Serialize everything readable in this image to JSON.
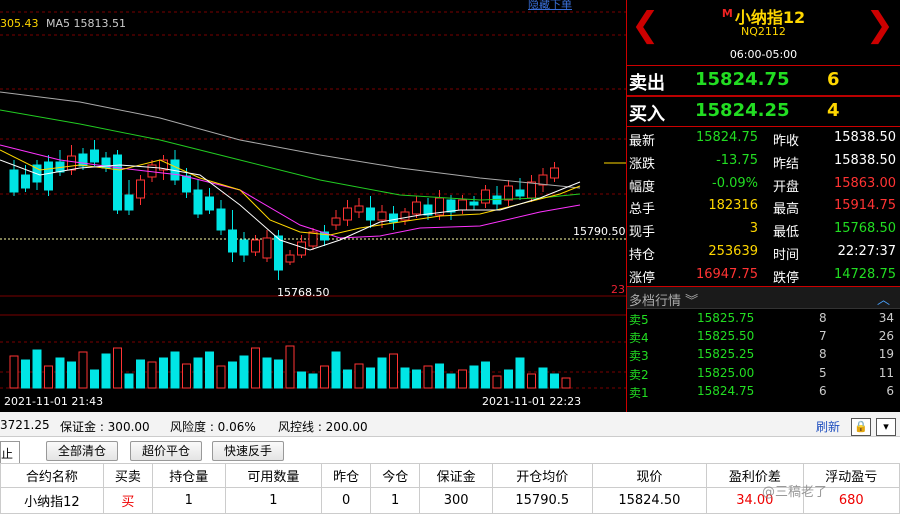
{
  "chart": {
    "ma_legend_value": "305.43",
    "ma_legend_ma5": "MA5  15813.51",
    "hide_order": "隐藏下单",
    "price_line_label": "15790.50",
    "low_label": "15768.50",
    "side_number": "23",
    "time_left": "2021-11-01 21:43",
    "time_right": "2021-11-01 22:23",
    "colors": {
      "up": "#ff3333",
      "down": "#00e5e5",
      "ma1": "#ffffff",
      "ma2": "#ffd700",
      "ma3": "#ff33ff",
      "ma4": "#22cc22",
      "ma5": "#aaaaaa"
    }
  },
  "panel": {
    "prev_icon": "chevron-left",
    "next_icon": "chevron-right",
    "badge": "M",
    "title": "小纳指12",
    "code": "NQ2112",
    "hours": "06:00-05:00",
    "sell": {
      "label": "卖出",
      "price": "15824.75",
      "vol": "6"
    },
    "buy": {
      "label": "买入",
      "price": "15824.25",
      "vol": "4"
    },
    "quote_rows": [
      {
        "k1": "最新",
        "v1": "15824.75",
        "c1": "g",
        "k2": "昨收",
        "v2": "15838.50",
        "c2": "w"
      },
      {
        "k1": "涨跌",
        "v1": "-13.75",
        "c1": "g",
        "k2": "昨结",
        "v2": "15838.50",
        "c2": "w"
      },
      {
        "k1": "幅度",
        "v1": "-0.09%",
        "c1": "g",
        "k2": "开盘",
        "v2": "15863.00",
        "c2": "r"
      },
      {
        "k1": "总手",
        "v1": "182316",
        "c1": "y",
        "k2": "最高",
        "v2": "15914.75",
        "c2": "r"
      },
      {
        "k1": "现手",
        "v1": "3",
        "c1": "y",
        "k2": "最低",
        "v2": "15768.50",
        "c2": "g"
      },
      {
        "k1": "持仓",
        "v1": "253639",
        "c1": "y",
        "k2": "时间",
        "v2": "22:27:37",
        "c2": "w"
      },
      {
        "k1": "涨停",
        "v1": "16947.75",
        "c1": "r",
        "k2": "跌停",
        "v2": "14728.75",
        "c2": "g"
      }
    ],
    "depth_title": "多档行情",
    "depth": [
      {
        "l": "卖5",
        "p": "15825.75",
        "v": "8",
        "t": "34"
      },
      {
        "l": "卖4",
        "p": "15825.50",
        "v": "7",
        "t": "26"
      },
      {
        "l": "卖3",
        "p": "15825.25",
        "v": "8",
        "t": "19"
      },
      {
        "l": "卖2",
        "p": "15825.00",
        "v": "5",
        "t": "11"
      },
      {
        "l": "卖1",
        "p": "15824.75",
        "v": "6",
        "t": "6"
      }
    ]
  },
  "account": {
    "balance_partial": "3721.25",
    "margin": "保证金 : 300.00",
    "risk": "风险度 : 0.06%",
    "risk_line": "风控线 : 200.00",
    "refresh": "刷新"
  },
  "buttons": {
    "tab": "止盈",
    "close_all": "全部清仓",
    "super_close": "超价平仓",
    "quick_reverse": "快速反手"
  },
  "table": {
    "headers": [
      "合约名称",
      "买卖",
      "持仓量",
      "可用数量",
      "昨仓",
      "今仓",
      "保证金",
      "开仓均价",
      "现价",
      "盈利价差",
      "浮动盈亏"
    ],
    "rows": [
      [
        "小纳指12",
        "买",
        "1",
        "1",
        "0",
        "1",
        "300",
        "15790.5",
        "15824.50",
        "34.00",
        "680"
      ]
    ]
  },
  "watermark": "@三稿老了"
}
